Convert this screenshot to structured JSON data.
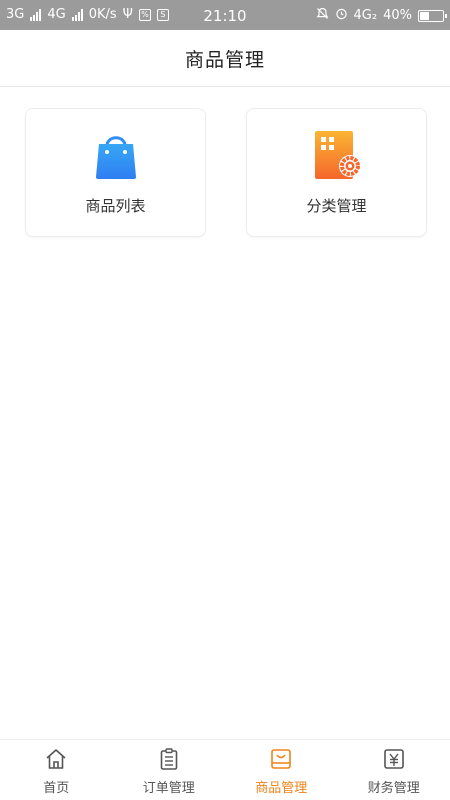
{
  "status_bar": {
    "net1": "3G",
    "net2": "4G",
    "speed": "0K/s",
    "sim_badge": "S",
    "time": "21:10",
    "net3": "4G₂",
    "battery": "40%"
  },
  "header": {
    "title": "商品管理"
  },
  "cards": [
    {
      "label": "商品列表",
      "icon": "shopping-bag-icon"
    },
    {
      "label": "分类管理",
      "icon": "category-settings-icon"
    }
  ],
  "tabbar": {
    "active_color": "#f08319",
    "items": [
      {
        "label": "首页",
        "icon": "home-icon"
      },
      {
        "label": "订单管理",
        "icon": "clipboard-icon"
      },
      {
        "label": "商品管理",
        "icon": "product-tray-icon",
        "active": true
      },
      {
        "label": "财务管理",
        "icon": "yuan-icon"
      }
    ]
  }
}
